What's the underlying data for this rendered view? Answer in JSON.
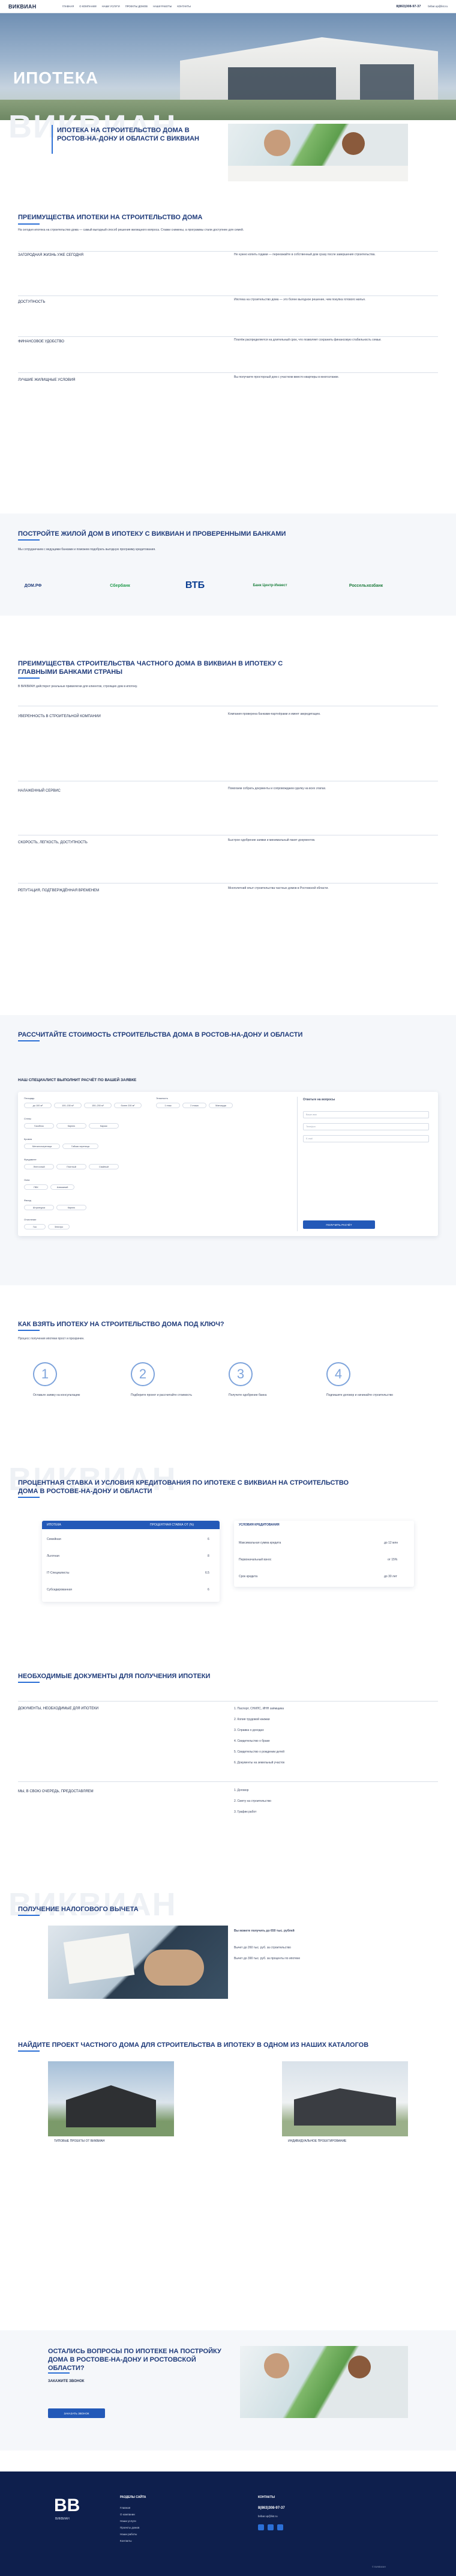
{
  "header": {
    "logo": "ВИКВИАН",
    "nav": [
      "Главная",
      "О компании",
      "Наши услуги",
      "Проекты домов",
      "Наши работы",
      "Контакты"
    ],
    "phone": "8(863)308-97-37",
    "email": "bribar.vp@list.ru"
  },
  "hero": {
    "title": "ИПОТЕКА"
  },
  "intro": {
    "watermark": "ВИКВИАН",
    "title": "ИПОТЕКА НА СТРОИТЕЛЬСТВО ДОМА В РОСТОВ-НА-ДОНУ И ОБЛАСТИ С ВИКВИАН"
  },
  "advantages": {
    "title": "ПРЕИМУЩЕСТВА ИПОТЕКИ НА СТРОИТЕЛЬСТВО ДОМА",
    "text": "На сегодня ипотека на строительство дома — самый выгодный способ решения жилищного вопроса. Ставки снижены, а программы стали доступнее для семей.",
    "items": [
      {
        "label": "ЗАГОРОДНАЯ ЖИЗНЬ УЖЕ СЕГОДНЯ",
        "text": "Не нужно копить годами — переезжайте в собственный дом сразу после завершения строительства."
      },
      {
        "label": "ДОСТУПНОСТЬ",
        "text": "Ипотека на строительство дома — это более выгодное решение, чем покупка готового жилья."
      },
      {
        "label": "ФИНАНСОВОЕ УДОБСТВО",
        "text": "Платёж распределяется на длительный срок, что позволяет сохранить финансовую стабильность семьи."
      },
      {
        "label": "ЛУЧШИЕ ЖИЛИЩНЫЕ УСЛОВИЯ",
        "text": "Вы получаете просторный дом с участком вместо квартиры в многоэтажке."
      }
    ]
  },
  "banks": {
    "title": "ПОСТРОЙТЕ ЖИЛОЙ ДОМ В ИПОТЕКУ С ВИКВИАН И ПРОВЕРЕННЫМИ БАНКАМИ",
    "text": "Мы сотрудничаем с ведущими банками и поможем подобрать выгодную программу кредитования.",
    "list": [
      "ДОМ.РФ",
      "Сбербанк",
      "ВТБ",
      "Банк Центр-Инвест",
      "Россельхозбанк"
    ]
  },
  "benefits": {
    "title": "ПРЕИМУЩЕСТВА СТРОИТЕЛЬСТВА ЧАСТНОГО ДОМА В ВИКВИАН В ИПОТЕКУ С ГЛАВНЫМИ БАНКАМИ СТРАНЫ",
    "subtitle": "В ВИКВИАН действуют реальные привилегии для клиентов, строящих дом в ипотеку.",
    "items": [
      {
        "label": "УВЕРЕННОСТЬ В СТРОИТЕЛЬНОЙ КОМПАНИИ",
        "text": "Компания проверена банками-партнёрами и имеет аккредитацию."
      },
      {
        "label": "НАЛАЖЕННЫЙ СЕРВИС",
        "text": "Помогаем собрать документы и сопровождаем сделку на всех этапах."
      },
      {
        "label": "СКОРОСТЬ, ЛЕГКОСТЬ, ДОСТУПНОСТЬ",
        "text": "Быстрое одобрение заявки и минимальный пакет документов."
      },
      {
        "label": "РЕПУТАЦИЯ, ПОДТВЕРЖДЁННАЯ ВРЕМЕНЕМ",
        "text": "Многолетний опыт строительства частных домов в Ростовской области."
      }
    ]
  },
  "calc": {
    "title": "РАССЧИТАЙТЕ СТОИМОСТЬ СТРОИТЕЛЬСТВА ДОМА В РОСТОВ-НА-ДОНУ И ОБЛАСТИ",
    "subtitle": "НАШ СПЕЦИАЛИСТ ВЫПОЛНИТ РАСЧЁТ ПО ВАШЕЙ ЗАЯВКЕ",
    "fields": {
      "area": "Площадь",
      "floors": "Этажность",
      "type": "Тип дома",
      "walls": "Стены",
      "roof": "Кровля",
      "foundation": "Фундамент",
      "windows": "Окна",
      "facade": "Фасад",
      "heating": "Отопление"
    },
    "chips": [
      "до 100 м²",
      "100–150 м²",
      "150–200 м²",
      "более 200 м²",
      "1 этаж",
      "2 этажа",
      "Мансарда",
      "Газоблок",
      "Кирпич",
      "Каркас",
      "Металлочерепица",
      "Гибкая черепица",
      "Ленточный",
      "Плитный",
      "Свайный",
      "ПВХ",
      "Алюминий",
      "Штукатурка",
      "Кирпич",
      "Газ",
      "Электро"
    ],
    "form_title": "Ответьте на вопросы",
    "placeholders": [
      "Ваше имя",
      "Телефон",
      "E-mail"
    ],
    "button": "ПОЛУЧИТЬ РАСЧЁТ"
  },
  "steps": {
    "title": "КАК ВЗЯТЬ ИПОТЕКУ НА СТРОИТЕЛЬСТВО ДОМА ПОД КЛЮЧ?",
    "subtitle": "Процесс получения ипотеки прост и прозрачен.",
    "list": [
      {
        "n": "1",
        "text": "Оставьте заявку на консультацию"
      },
      {
        "n": "2",
        "text": "Подберите проект и рассчитайте стоимость"
      },
      {
        "n": "3",
        "text": "Получите одобрение банка"
      },
      {
        "n": "4",
        "text": "Подпишите договор и начинайте строительство"
      }
    ]
  },
  "rates": {
    "title": "ПРОЦЕНТНАЯ СТАВКА И УСЛОВИЯ КРЕДИТОВАНИЯ ПО ИПОТЕКЕ С ВИКВИАН НА СТРОИТЕЛЬСТВО ДОМА В РОСТОВЕ-НА-ДОНУ И ОБЛАСТИ",
    "left_head": [
      "ИПОТЕКА",
      "ПРОЦЕНТНАЯ СТАВКА ОТ (%)"
    ],
    "left_rows": [
      [
        "Семейная",
        "6"
      ],
      [
        "Льготная",
        "8"
      ],
      [
        "IT-Специалисты",
        "6.5"
      ],
      [
        "Субсидированная",
        "6"
      ]
    ],
    "right_head": "УСЛОВИЯ КРЕДИТОВАНИЯ",
    "right_rows": [
      [
        "Максимальная сумма кредита",
        "до 12 млн"
      ],
      [
        "Первоначальный взнос",
        "от 15%"
      ],
      [
        "Срок кредита",
        "до 30 лет"
      ]
    ]
  },
  "docs": {
    "title": "НЕОБХОДИМЫЕ ДОКУМЕНТЫ ДЛЯ ПОЛУЧЕНИЯ ИПОТЕКИ",
    "left1": "ДОКУМЕНТЫ, НЕОБХОДИМЫЕ ДЛЯ ИПОТЕКИ",
    "list1": [
      "1. Паспорт, СНИЛС, ИНН заёмщика",
      "2. Копия трудовой книжки",
      "3. Справка о доходах",
      "4. Свидетельство о браке",
      "5. Свидетельство о рождении детей",
      "6. Документы на земельный участок"
    ],
    "left2": "МЫ, В СВОЮ ОЧЕРЕДЬ, ПРЕДОСТАВЛЯЕМ",
    "list2": [
      "1. Договор",
      "2. Смету на строительство",
      "3. График работ"
    ]
  },
  "tax": {
    "title": "ПОЛУЧЕНИЕ НАЛОГОВОГО ВЫЧЕТА",
    "lines": [
      "Вы можете получить до 650 тыс. рублей",
      "Вычет до 260 тыс. руб. за строительство",
      "Вычет до 390 тыс. руб. за проценты по ипотеке"
    ]
  },
  "catalog": {
    "title": "НАЙДИТЕ ПРОЕКТ ЧАСТНОГО ДОМА ДЛЯ СТРОИТЕЛЬСТВА В ИПОТЕКУ В ОДНОМ ИЗ НАШИХ КАТАЛОГОВ",
    "items": [
      {
        "label": "ТИПОВЫЕ ПРОЕКТЫ ОТ ВИКВИАН"
      },
      {
        "label": "ИНДИВИДУАЛЬНОЕ ПРОЕКТИРОВАНИЕ"
      }
    ]
  },
  "cta": {
    "title": "ОСТАЛИСЬ ВОПРОСЫ ПО ИПОТЕКЕ НА ПОСТРОЙКУ ДОМА В РОСТОВЕ-НА-ДОНУ И РОСТОВСКОЙ ОБЛАСТИ?",
    "sub": "ЗАКАЖИТЕ ЗВОНОК",
    "button": "ЗАКАЗАТЬ ЗВОНОК"
  },
  "footer": {
    "logo": "BB",
    "sub": "ВИКВИАН",
    "col1_title": "РАЗДЕЛЫ САЙТА",
    "col1": [
      "Главная",
      "О компании",
      "Наши услуги",
      "Проекты домов",
      "Наши работы",
      "Контакты"
    ],
    "col2_title": "КОНТАКТЫ",
    "phone": "8(863)308-97-37",
    "email": "bribar.vp@list.ru",
    "copy": "© ВИКВИАН"
  }
}
